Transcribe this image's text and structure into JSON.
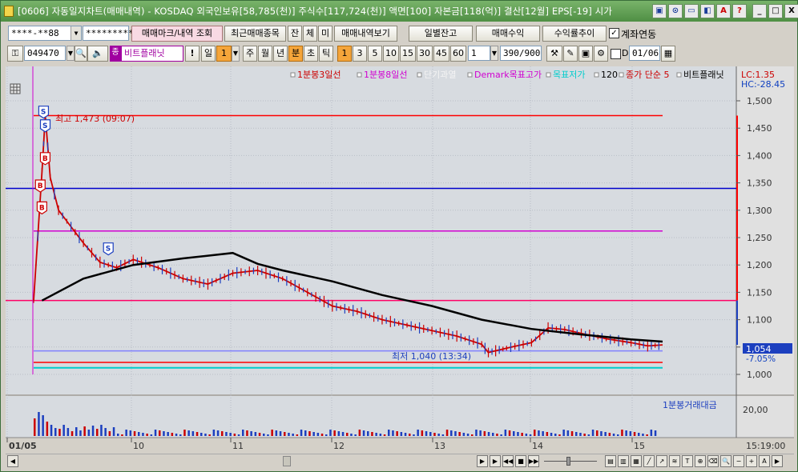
{
  "window": {
    "title": "[0606] 자동일지차트(매매내역) - KOSDAQ 외국인보유[58,785(천)] 주식수[117,724(천)] 액면[100] 자본금[118(억)] 결산[12월] EPS[-19] 시가",
    "title_buttons": [
      "▣",
      "⊙",
      "▭",
      "◧",
      "A",
      "?"
    ],
    "window_buttons": [
      "_",
      "□",
      "X"
    ]
  },
  "toolbar1": {
    "account_value": "****-**88",
    "password_value": "*********",
    "trade_mark_btn": "매매마크/내역 조회",
    "recent_btn": "최근매매종목",
    "jan_btn": "잔",
    "che_btn": "체",
    "mi_btn": "미",
    "history_btn": "매매내역보기",
    "daily_balance_btn": "일별잔고",
    "trade_profit_btn": "매매수익",
    "profit_rate_btn": "수익률추이",
    "account_link_label": "계좌연동",
    "account_link_checked": true
  },
  "toolbar2": {
    "stock_code": "049470",
    "stock_name": "비트플래닛",
    "stock_prefix": "종",
    "alert_btn": "!",
    "period_label": "일",
    "period_value": "1",
    "periods": [
      "주",
      "월",
      "년",
      "분",
      "초",
      "틱"
    ],
    "active_period": "분",
    "intervals": [
      "1",
      "3",
      "5",
      "10",
      "15",
      "30",
      "45",
      "60"
    ],
    "active_interval": "1",
    "count_value": "1",
    "view_count": "390/900",
    "date_field": "01/06",
    "d_label": "D"
  },
  "legend": [
    {
      "text": "1분봉3일선",
      "color": "#cc0000"
    },
    {
      "text": "1분봉8일선",
      "color": "#d000d0"
    },
    {
      "text": "단기과열",
      "color": "#e8e8e8"
    },
    {
      "text": "Demark목표고가",
      "color": "#d000d0"
    },
    {
      "text": "목표저가",
      "color": "#00cccc"
    },
    {
      "text": "120",
      "color": "#000000"
    },
    {
      "text": "종가 단순 5",
      "color": "#cc0000"
    },
    {
      "text": "비트플래닛",
      "color": "#000000"
    }
  ],
  "axis": {
    "lc_label": "LC:1.35",
    "hc_label": "HC:-28.45",
    "y_ticks": [
      "1,500",
      "1,450",
      "1,400",
      "1,350",
      "1,300",
      "1,250",
      "1,200",
      "1,150",
      "1,100",
      "1,050",
      "1,000"
    ],
    "current_price": "1,054",
    "current_change": "-7.05%",
    "volume_tick": "20,00",
    "x_labels": [
      "01/05",
      "10",
      "11",
      "12",
      "13",
      "14",
      "15"
    ],
    "time_label": "15:19:00"
  },
  "annotations": {
    "high": "최고 1,473 (09:07)",
    "low": "최저 1,040 (13:34)",
    "volume_legend": "1분봉거래대금"
  },
  "chart_data": {
    "type": "line",
    "title": "",
    "ylim": [
      965,
      1525
    ],
    "series": [
      {
        "name": "비트플래닛",
        "color": "#cc0000",
        "x": [
          "09:00",
          "09:05",
          "09:07",
          "09:10",
          "09:15",
          "09:20",
          "09:30",
          "09:40",
          "09:50",
          "10:00",
          "10:15",
          "10:30",
          "10:45",
          "11:00",
          "11:15",
          "11:30",
          "11:45",
          "12:00",
          "12:15",
          "12:30",
          "12:45",
          "13:00",
          "13:15",
          "13:30",
          "13:34",
          "13:45",
          "14:00",
          "14:10",
          "14:20",
          "14:30",
          "14:45",
          "15:00",
          "15:10",
          "15:19"
        ],
        "values": [
          1135,
          1370,
          1473,
          1360,
          1300,
          1280,
          1240,
          1205,
          1195,
          1210,
          1195,
          1175,
          1165,
          1185,
          1190,
          1175,
          1150,
          1125,
          1115,
          1100,
          1090,
          1080,
          1070,
          1055,
          1040,
          1048,
          1058,
          1085,
          1082,
          1075,
          1065,
          1058,
          1052,
          1054
        ]
      },
      {
        "name": "120",
        "color": "#000000",
        "x": [
          "09:05",
          "09:30",
          "10:00",
          "10:30",
          "11:00",
          "11:15",
          "11:30",
          "12:00",
          "12:30",
          "13:00",
          "13:30",
          "14:00",
          "14:30",
          "15:00",
          "15:19"
        ],
        "values": [
          1135,
          1175,
          1200,
          1212,
          1222,
          1202,
          1190,
          1170,
          1145,
          1125,
          1100,
          1083,
          1073,
          1064,
          1060
        ]
      }
    ],
    "horizontal_lines": [
      {
        "label": "최고",
        "value": 1473,
        "color": "#ff0000"
      },
      {
        "label": "1분봉8일선",
        "value": 1340,
        "color": "#0000cc"
      },
      {
        "label": "Demark목표고가",
        "value": 1262,
        "color": "#d000d0"
      },
      {
        "label": "1분봉3일선",
        "value": 1135,
        "color": "#ff0066"
      },
      {
        "label": "종가 단순 5",
        "value": 1043,
        "color": "#8080ff"
      },
      {
        "label": "단기과열",
        "value": 1022,
        "color": "#ff0000"
      },
      {
        "label": "목표저가",
        "value": 1012,
        "color": "#00cccc"
      }
    ],
    "trade_marks": [
      {
        "type": "S",
        "time": "09:06"
      },
      {
        "type": "S",
        "time": "09:07"
      },
      {
        "type": "B",
        "time": "09:06"
      },
      {
        "type": "B",
        "time": "09:04"
      },
      {
        "type": "B",
        "time": "09:05"
      },
      {
        "type": "S",
        "time": "09:45"
      }
    ]
  }
}
